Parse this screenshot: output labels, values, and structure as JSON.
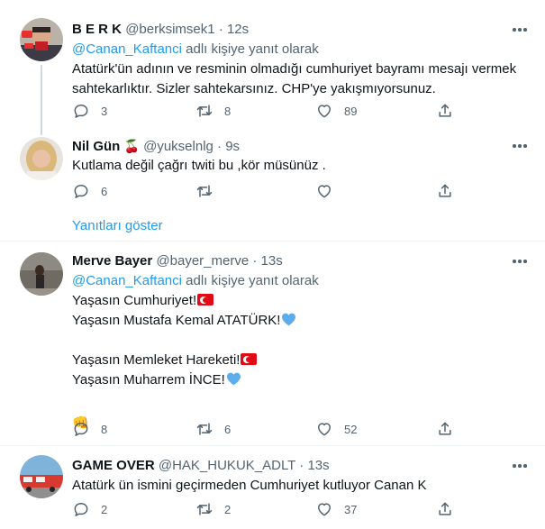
{
  "tweets": [
    {
      "name": "B E R K",
      "handle": "@berksimsek1",
      "time": "12s",
      "reply_to_mention": "@Canan_Kaftanci",
      "reply_to_suffix": " adlı kişiye yanıt olarak",
      "lines": [
        "Atatürk'ün adının ve resminin olmadığı cumhuriyet bayramı mesajı vermek",
        "sahtekarlıktır. Sizler sahtekarsınız. CHP'ye yakışmıyorsunuz."
      ],
      "replies": "3",
      "retweets": "8",
      "likes": "89"
    },
    {
      "name": "Nil Gün",
      "name_emoji": "🍒",
      "handle": "@yukselnlg",
      "time": "9s",
      "lines": [
        "Kutlama değil çağrı twiti bu ,kör müsünüz ."
      ],
      "replies": "6",
      "retweets": "",
      "likes": ""
    },
    {
      "name": "Merve Bayer",
      "handle": "@bayer_merve",
      "time": "13s",
      "reply_to_mention": "@Canan_Kaftanci",
      "reply_to_suffix": " adlı kişiye yanıt olarak",
      "lines": [
        "Yaşasın Cumhuriyet!",
        "Yaşasın Mustafa Kemal ATATÜRK!",
        "",
        "Yaşasın Memleket Hareketi!",
        "Yaşasın Muharrem İNCE!",
        "",
        "👊"
      ],
      "replies": "8",
      "retweets": "6",
      "likes": "52"
    },
    {
      "name": "GAME OVER",
      "handle": "@HAK_HUKUK_ADLT",
      "time": "13s",
      "lines": [
        "Atatürk ün ismini geçirmeden Cumhuriyet kutluyor Canan K"
      ],
      "replies": "2",
      "retweets": "2",
      "likes": "37"
    }
  ],
  "show_replies_label": "Yanıtları göster",
  "separator": "·",
  "colors": {
    "accent": "#1d9bf0",
    "secondary_text": "#536471",
    "divider": "#eff3f4"
  }
}
